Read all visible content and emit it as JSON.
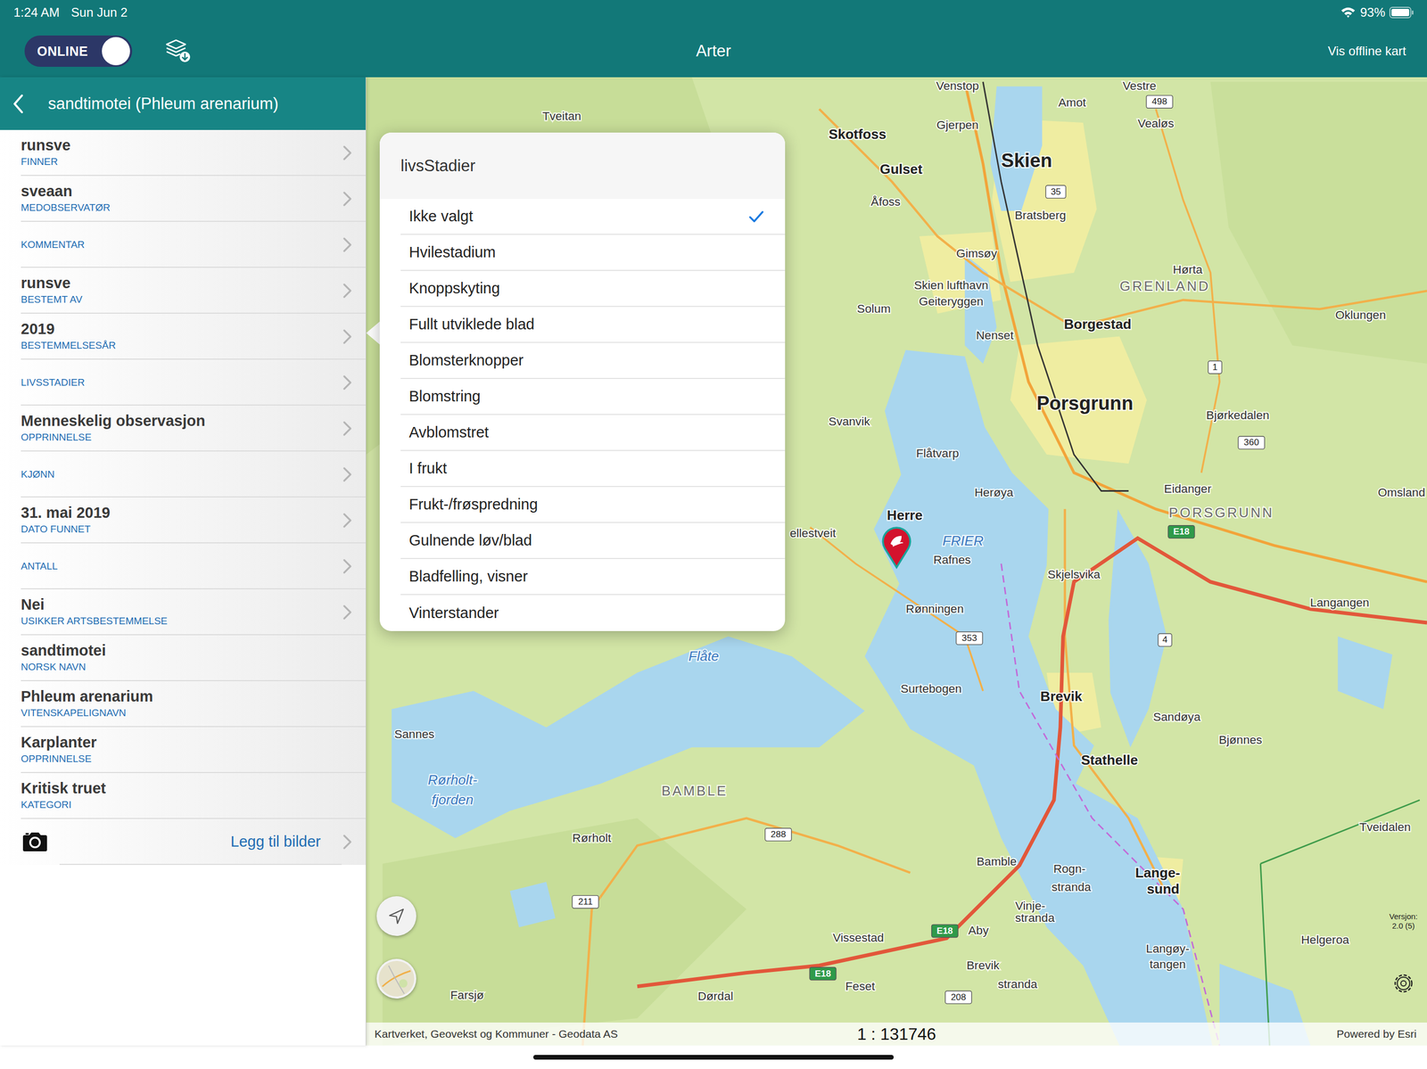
{
  "status_bar": {
    "time": "1:24 AM",
    "date": "Sun Jun 2",
    "battery": "93%"
  },
  "topbar": {
    "online_toggle": {
      "label": "ONLINE",
      "on": true
    },
    "title": "Arter",
    "offline_button": "Vis offline kart"
  },
  "sidebar": {
    "title": "sandtimotei (Phleum arenarium)",
    "items": [
      {
        "value": "runsve",
        "label": "FINNER",
        "kind": "link"
      },
      {
        "value": "sveaan",
        "label": "MEDOBSERVATØR",
        "kind": "link"
      },
      {
        "label": "KOMMENTAR",
        "kind": "link"
      },
      {
        "value": "runsve",
        "label": "BESTEMT AV",
        "kind": "link"
      },
      {
        "value": "2019",
        "label": "BESTEMMELSESÅR",
        "kind": "link"
      },
      {
        "label": "LIVSSTADIER",
        "kind": "link"
      },
      {
        "value": "Menneskelig observasjon",
        "label": "OPPRINNELSE",
        "kind": "link"
      },
      {
        "label": "KJØNN",
        "kind": "link"
      },
      {
        "value": "31. mai 2019",
        "label": "DATO FUNNET",
        "kind": "link"
      },
      {
        "label": "ANTALL",
        "kind": "link"
      },
      {
        "value": "Nei",
        "label": "USIKKER ARTSBESTEMMELSE",
        "kind": "link"
      },
      {
        "value": "sandtimotei",
        "label": "NORSK NAVN",
        "kind": "static"
      },
      {
        "value": "Phleum arenarium",
        "label": "VITENSKAPELIGNAVN",
        "kind": "static"
      },
      {
        "value": "Karplanter",
        "label": "OPPRINNELSE",
        "kind": "static"
      },
      {
        "value": "Kritisk truet",
        "label": "KATEGORI",
        "kind": "static"
      }
    ],
    "photo_button": "Legg til bilder"
  },
  "popover": {
    "title": "livsStadier",
    "options": [
      {
        "label": "Ikke valgt",
        "selected": true
      },
      {
        "label": "Hvilestadium",
        "selected": false
      },
      {
        "label": "Knoppskyting",
        "selected": false
      },
      {
        "label": "Fullt utviklede blad",
        "selected": false
      },
      {
        "label": "Blomsterknopper",
        "selected": false
      },
      {
        "label": "Blomstring",
        "selected": false
      },
      {
        "label": "Avblomstret",
        "selected": false
      },
      {
        "label": "I frukt",
        "selected": false
      },
      {
        "label": "Frukt-/frøspredning",
        "selected": false
      },
      {
        "label": "Gulnende løv/blad",
        "selected": false
      },
      {
        "label": "Bladfelling, visner",
        "selected": false
      },
      {
        "label": "Vinterstander",
        "selected": false
      }
    ]
  },
  "map": {
    "labels": [
      {
        "text": "Venstop",
        "kind": "place"
      },
      {
        "text": "Vestre",
        "kind": "place"
      },
      {
        "text": "Amot",
        "kind": "place"
      },
      {
        "text": "Tveitan",
        "kind": "place"
      },
      {
        "text": "Skotfoss",
        "kind": "town"
      },
      {
        "text": "Gjerpen",
        "kind": "place"
      },
      {
        "text": "Vealøs",
        "kind": "place"
      },
      {
        "text": "Skien",
        "kind": "city"
      },
      {
        "text": "Gulset",
        "kind": "town"
      },
      {
        "text": "Bratsberg",
        "kind": "place"
      },
      {
        "text": "Åfoss",
        "kind": "place"
      },
      {
        "text": "Gimsøy",
        "kind": "place"
      },
      {
        "text": "Hørta",
        "kind": "place"
      },
      {
        "text": "GRENLAND",
        "kind": "region"
      },
      {
        "text": "Skien lufthavn",
        "kind": "place"
      },
      {
        "text": "Geiteryggen",
        "kind": "place"
      },
      {
        "text": "Solum",
        "kind": "place"
      },
      {
        "text": "Borgestad",
        "kind": "town"
      },
      {
        "text": "Oklungen",
        "kind": "place"
      },
      {
        "text": "Nenset",
        "kind": "place"
      },
      {
        "text": "Porsgrunn",
        "kind": "city"
      },
      {
        "text": "Bjørkedalen",
        "kind": "place"
      },
      {
        "text": "Svanvik",
        "kind": "place"
      },
      {
        "text": "Flåtvarp",
        "kind": "place"
      },
      {
        "text": "Herøya",
        "kind": "place"
      },
      {
        "text": "Eidanger",
        "kind": "place"
      },
      {
        "text": "Omsland",
        "kind": "place"
      },
      {
        "text": "PORSGRUNN",
        "kind": "region"
      },
      {
        "text": "Herre",
        "kind": "town"
      },
      {
        "text": "FRIER",
        "kind": "water"
      },
      {
        "text": "Rafnes",
        "kind": "place"
      },
      {
        "text": "ellestveit",
        "kind": "place"
      },
      {
        "text": "Skjelsvika",
        "kind": "place"
      },
      {
        "text": "Langangen",
        "kind": "place"
      },
      {
        "text": "Rønningen",
        "kind": "place"
      },
      {
        "text": "Flåte",
        "kind": "water"
      },
      {
        "text": "Surtebogen",
        "kind": "place"
      },
      {
        "text": "Brevik",
        "kind": "town"
      },
      {
        "text": "Sandøya",
        "kind": "place"
      },
      {
        "text": "Bjønnes",
        "kind": "place"
      },
      {
        "text": "Stathelle",
        "kind": "town"
      },
      {
        "text": "Sannes",
        "kind": "place"
      },
      {
        "text": "Rørholt-",
        "kind": "water"
      },
      {
        "text": "fjorden",
        "kind": "water"
      },
      {
        "text": "BAMBLE",
        "kind": "region"
      },
      {
        "text": "Tveidalen",
        "kind": "place"
      },
      {
        "text": "Rørholt",
        "kind": "place"
      },
      {
        "text": "Bamble",
        "kind": "place"
      },
      {
        "text": "Rogn-",
        "kind": "place"
      },
      {
        "text": "stranda",
        "kind": "place"
      },
      {
        "text": "Lange-",
        "kind": "town"
      },
      {
        "text": "sund",
        "kind": "town"
      },
      {
        "text": "Vinje-",
        "kind": "place"
      },
      {
        "text": "stranda",
        "kind": "place"
      },
      {
        "text": "Vissestad",
        "kind": "place"
      },
      {
        "text": "Aby",
        "kind": "place"
      },
      {
        "text": "Helgeroa",
        "kind": "place"
      },
      {
        "text": "Langøy-",
        "kind": "place"
      },
      {
        "text": "tangen",
        "kind": "place"
      },
      {
        "text": "Brevik",
        "kind": "place"
      },
      {
        "text": "Farsjø",
        "kind": "place"
      },
      {
        "text": "Dørdal",
        "kind": "place"
      },
      {
        "text": "Feset",
        "kind": "place"
      },
      {
        "text": "stranda",
        "kind": "place"
      },
      {
        "text": "35",
        "kind": "road"
      },
      {
        "text": "353",
        "kind": "road"
      },
      {
        "text": "211",
        "kind": "road"
      },
      {
        "text": "288",
        "kind": "road"
      },
      {
        "text": "208",
        "kind": "road"
      },
      {
        "text": "E18",
        "kind": "highway"
      },
      {
        "text": "E18",
        "kind": "highway"
      },
      {
        "text": "E18",
        "kind": "highway"
      },
      {
        "text": "1",
        "kind": "road"
      },
      {
        "text": "4",
        "kind": "road"
      },
      {
        "text": "360",
        "kind": "road"
      },
      {
        "text": "498",
        "kind": "road"
      }
    ],
    "scale": "1 : 131746",
    "attribution": "Kartverket, Geovekst og Kommuner - Geodata AS",
    "powered_by": "Powered by Esri",
    "version_label": "Versjon:",
    "version": "2.0 (5)"
  }
}
